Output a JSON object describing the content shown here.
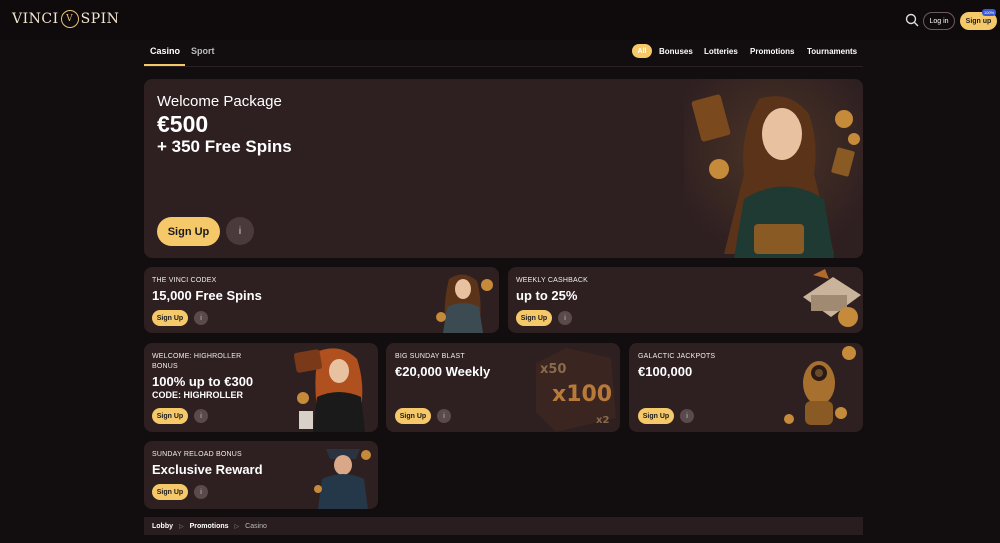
{
  "header": {
    "logo_left": "VINCI",
    "logo_mark": "V",
    "logo_right": "SPIN",
    "login_label": "Log in",
    "signup_label": "Sign up",
    "signup_badge": "100%"
  },
  "nav": {
    "tabs": [
      {
        "label": "Casino",
        "active": true
      },
      {
        "label": "Sport",
        "active": false
      }
    ],
    "filters": [
      "All",
      "Bonuses",
      "Lotteries",
      "Promotions",
      "Tournaments"
    ]
  },
  "hero": {
    "title": "Welcome Package",
    "amount": "€500",
    "spins": "+ 350 Free Spins",
    "button": "Sign Up",
    "info": "i"
  },
  "promos": [
    {
      "kicker": "THE VINCI CODEX",
      "headline": "15,000 Free Spins",
      "button": "Sign Up",
      "info": "i"
    },
    {
      "kicker": "WEEKLY CASHBACK",
      "headline": "up to 25%",
      "button": "Sign Up",
      "info": "i"
    },
    {
      "kicker": "WELCOME: HIGHROLLER BONUS",
      "headline": "100% up to €300",
      "code": "CODE: HIGHROLLER",
      "button": "Sign Up",
      "info": "i"
    },
    {
      "kicker": "BIG SUNDAY BLAST",
      "headline": "€20,000 Weekly",
      "button": "Sign Up",
      "info": "i",
      "art_text": [
        "x50",
        "x100",
        "x2"
      ]
    },
    {
      "kicker": "GALACTIC JACKPOTS",
      "headline": "€100,000",
      "button": "Sign Up",
      "info": "i"
    },
    {
      "kicker": "SUNDAY RELOAD BONUS",
      "headline": "Exclusive Reward",
      "button": "Sign Up",
      "info": "i"
    }
  ],
  "breadcrumb": [
    "Lobby",
    "Promotions",
    "Casino"
  ],
  "colors": {
    "accent": "#f5c86a",
    "card_bg": "#2e1f21",
    "page_bg": "#120d0e"
  }
}
